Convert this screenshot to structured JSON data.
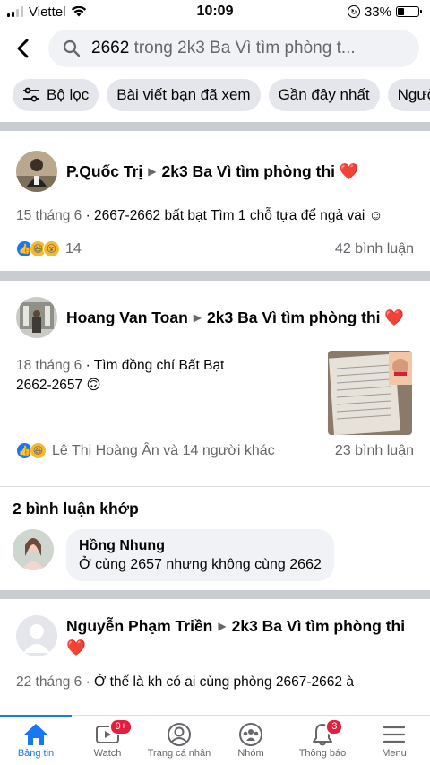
{
  "status_bar": {
    "carrier": "Viettel",
    "time": "10:09",
    "battery": "33%",
    "battery_level": 0.33
  },
  "search": {
    "query": "2662",
    "query_rest": "trong 2k3 Ba Vì tìm phòng t..."
  },
  "filters": [
    {
      "label": "Bộ lọc"
    },
    {
      "label": "Bài viết bạn đã xem"
    },
    {
      "label": "Gần đây nhất"
    },
    {
      "label": "Người c"
    }
  ],
  "posts": [
    {
      "author": "P.Quốc Trị",
      "group": "2k3 Ba Vì tìm phòng thi",
      "date": "15 tháng 6",
      "text": "· 2667-2662 bất bạt  Tìm 1 chỗ tựa để ngả vai ☺",
      "reaction_count": "14",
      "comments": "42 bình luận"
    },
    {
      "author": "Hoang Van Toan",
      "group": "2k3 Ba Vì tìm phòng thi",
      "date": "18 tháng 6",
      "text": "· Tìm đồng chí Bất Bạt",
      "text2": "2662-2657 🙃",
      "reaction_names": "Lê Thị Hoàng Ân và 14 người khác",
      "comments": "23 bình luận"
    },
    {
      "author": "Nguyễn Phạm Triền",
      "group": "2k3 Ba Vì tìm phòng thi",
      "date": "22 tháng 6",
      "text": "· Ở thế là kh có ai cùng  phòng 2667-2662 à"
    }
  ],
  "matching": {
    "title": "2 bình luận khớp",
    "comment": {
      "name": "Hồng Nhung",
      "text": "Ở cùng 2657 nhưng không cùng 2662"
    }
  },
  "nav": {
    "items": [
      {
        "label": "Bảng tin",
        "icon": "home-icon"
      },
      {
        "label": "Watch",
        "icon": "watch-icon",
        "badge": "9+"
      },
      {
        "label": "Trang cá nhân",
        "icon": "profile-icon"
      },
      {
        "label": "Nhóm",
        "icon": "groups-icon"
      },
      {
        "label": "Thông báo",
        "icon": "bell-icon",
        "badge": "3"
      },
      {
        "label": "Menu",
        "icon": "menu-icon"
      }
    ]
  },
  "colors": {
    "accent": "#1877f2",
    "heart": "#e41e3f",
    "divider": "#c9ccd1"
  }
}
